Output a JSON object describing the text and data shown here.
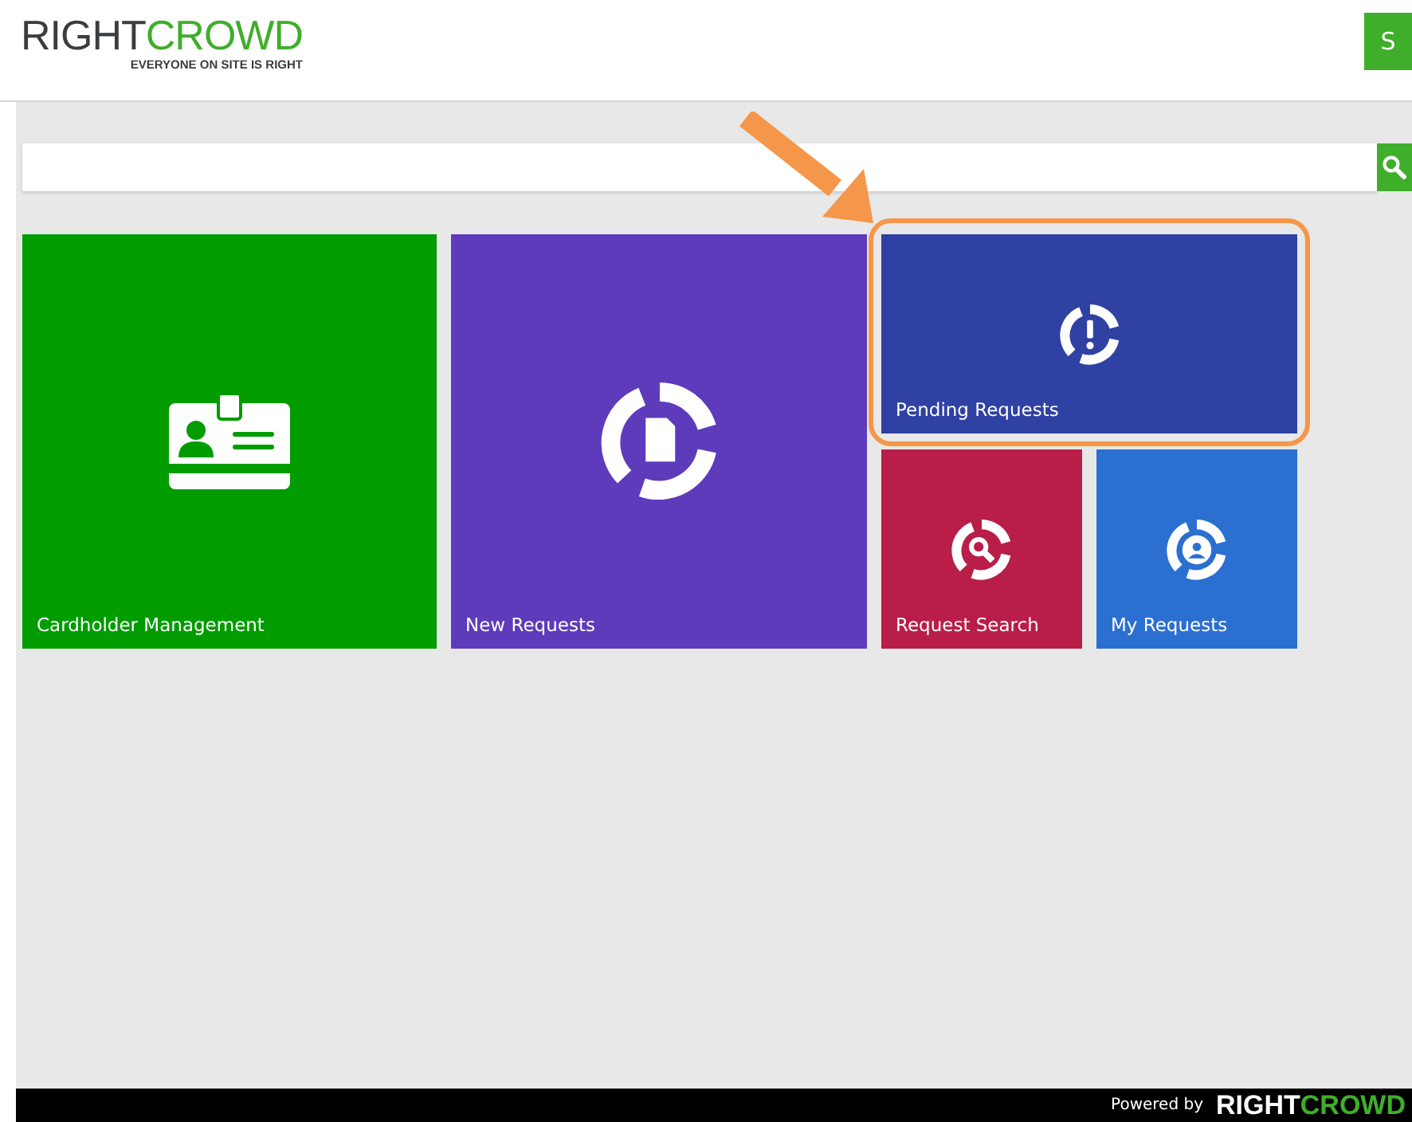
{
  "header": {
    "logo": "RIGHT**CROWD**",
    "tagline": "EVERYONE ON SITE IS RIGHT",
    "user_button": "S"
  },
  "tiles": [
    {
      "label": "Cardholder Management",
      "color": "#009c00",
      "highlighted": false
    },
    {
      "label": "New Requests",
      "color": "#5e3bbb",
      "highlighted": false
    },
    {
      "label": "Pending Requests",
      "color": "#2f41a3",
      "highlighted": true
    },
    {
      "label": "Request Search",
      "color": "#b91e48",
      "highlighted": false
    },
    {
      "label": "My Requests",
      "color": "#2b6fd1",
      "highlighted": false
    }
  ],
  "footer": {
    "powered_by": "Powered by",
    "logo": "RIGHT**CROWD**"
  }
}
